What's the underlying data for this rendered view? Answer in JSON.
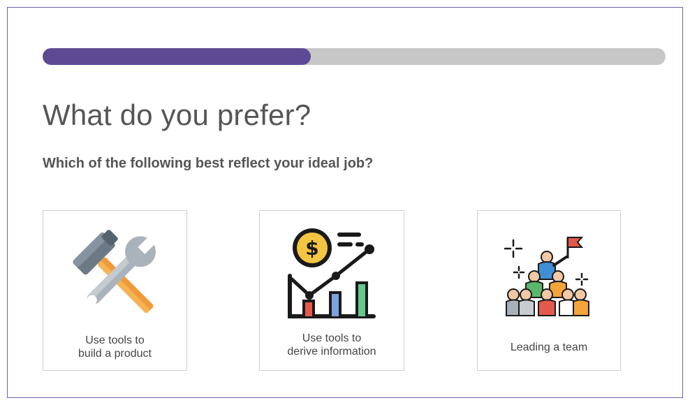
{
  "progress": {
    "value_percent": 43,
    "fill_color": "#5e4a94",
    "track_color": "#c7c7c7"
  },
  "page": {
    "title": "What do you prefer?",
    "subtitle": "Which of the following best reflect your ideal job?"
  },
  "options": [
    {
      "line1": "Use tools to",
      "line2": "build a product",
      "icon": "tools-icon"
    },
    {
      "line1": "Use tools to",
      "line2": "derive information",
      "icon": "finance-chart-icon"
    },
    {
      "line1": "Leading a team",
      "icon": "team-leader-icon"
    }
  ],
  "colors": {
    "accent": "#5e4a94",
    "border": "#6b5fa6",
    "text": "#555555"
  }
}
